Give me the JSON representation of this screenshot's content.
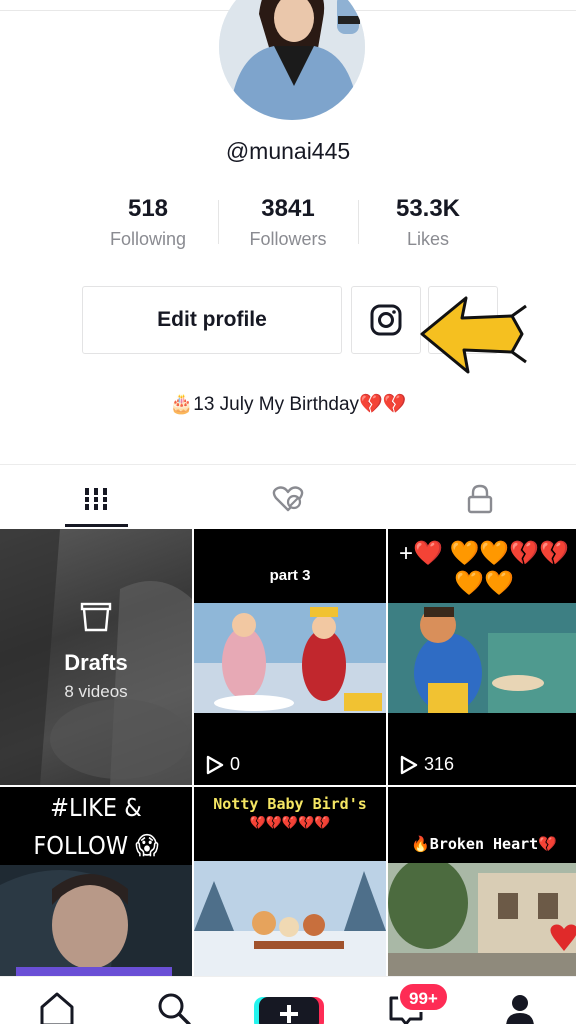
{
  "profile": {
    "username": "@munai445",
    "stats": [
      {
        "value": "518",
        "label": "Following"
      },
      {
        "value": "3841",
        "label": "Followers"
      },
      {
        "value": "53.3K",
        "label": "Likes"
      }
    ],
    "edit_label": "Edit profile",
    "bio": "🎂13 July My Birthday💔💔"
  },
  "tabs": [
    {
      "icon": "grid-icon",
      "active": true
    },
    {
      "icon": "liked-icon",
      "active": false
    },
    {
      "icon": "lock-icon",
      "active": false
    }
  ],
  "grid": {
    "drafts": {
      "title": "Drafts",
      "count": "8 videos"
    },
    "videos": [
      {
        "caption": "part 3",
        "plays": "0"
      },
      {
        "caption": "+❤️ 🧡🧡💔💔🧡🧡",
        "plays": "316"
      },
      {
        "caption": "#LIKE & FOLLOW 😱"
      },
      {
        "caption": "Notty Baby Bird's",
        "sub": "💔💔💔💔💔"
      },
      {
        "caption": "🔥Broken Heart💔"
      }
    ]
  },
  "bottom_nav": {
    "badge": "99+"
  },
  "colors": {
    "accent": "#fe2c55",
    "arrow": "#f5c020",
    "text": "#161823",
    "muted": "#8a8b91"
  }
}
